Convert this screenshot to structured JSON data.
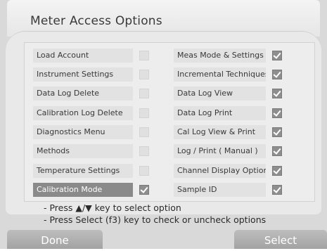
{
  "title": "Meter Access Options",
  "options_left": [
    {
      "label": "Load Account",
      "checked": false,
      "selected": false
    },
    {
      "label": "Instrument Settings",
      "checked": false,
      "selected": false
    },
    {
      "label": "Data Log Delete",
      "checked": false,
      "selected": false
    },
    {
      "label": "Calibration Log Delete",
      "checked": false,
      "selected": false
    },
    {
      "label": "Diagnostics Menu",
      "checked": false,
      "selected": false
    },
    {
      "label": "Methods",
      "checked": false,
      "selected": false
    },
    {
      "label": "Temperature Settings",
      "checked": false,
      "selected": false
    },
    {
      "label": "Calibration Mode",
      "checked": true,
      "selected": true
    }
  ],
  "options_right": [
    {
      "label": "Meas Mode & Settings",
      "checked": true,
      "selected": false
    },
    {
      "label": "Incremental Techniques",
      "checked": true,
      "selected": false
    },
    {
      "label": "Data Log View",
      "checked": true,
      "selected": false
    },
    {
      "label": "Data Log Print",
      "checked": true,
      "selected": false
    },
    {
      "label": "Cal Log View & Print",
      "checked": true,
      "selected": false
    },
    {
      "label": "Log / Print ( Manual )",
      "checked": true,
      "selected": false
    },
    {
      "label": "Channel Display Option",
      "checked": true,
      "selected": false
    },
    {
      "label": "Sample ID",
      "checked": true,
      "selected": false
    }
  ],
  "instructions": {
    "line1": "- Press ▲/▼ key to select option",
    "line2": "- Press Select (f3) key to check or uncheck options"
  },
  "softkeys": {
    "left": "Done",
    "right": "Select"
  }
}
